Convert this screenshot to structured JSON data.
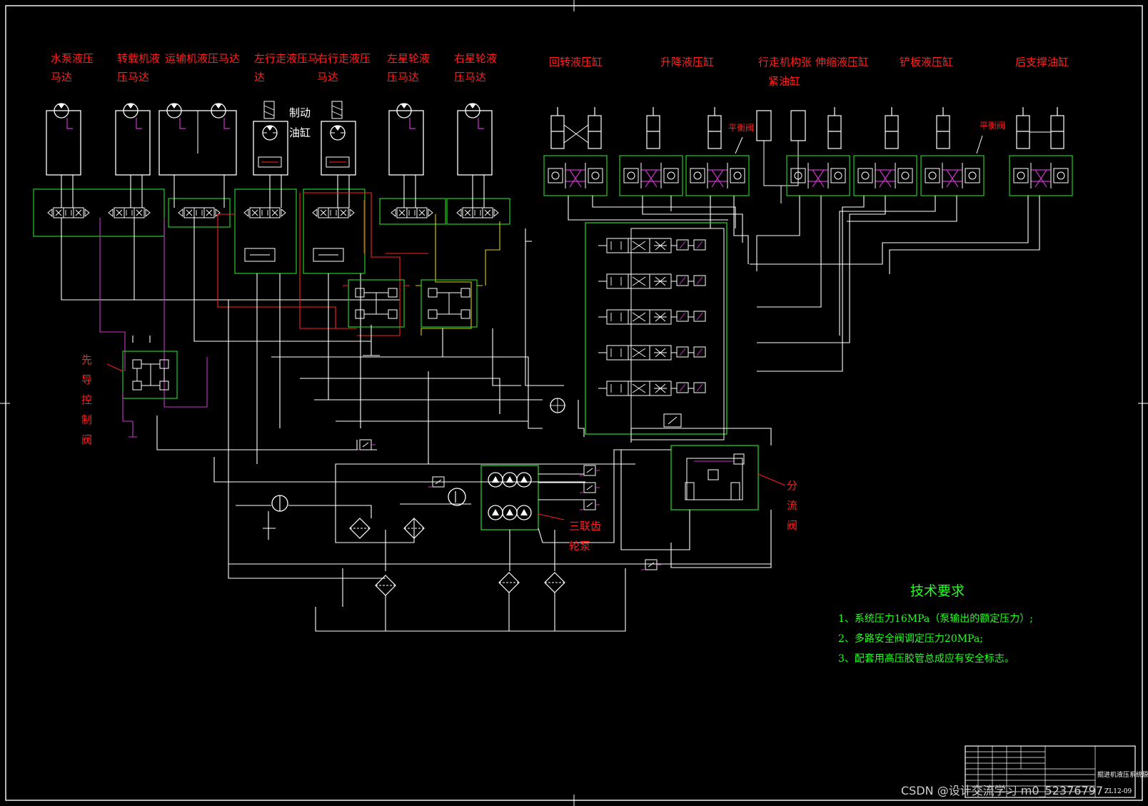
{
  "colors": {
    "background": "#000000",
    "line": "#ffffff",
    "pilot_line": "#cc33cc",
    "travel_line": "#ff2020",
    "planet_line": "#e0d000",
    "frame_green": "#22cc22",
    "label_red": "#ff2020",
    "note_green": "#22ff22"
  },
  "labels": {
    "water_pump_motor": [
      "水泵液压",
      "马达"
    ],
    "loader_motor": [
      "转载机液",
      "压马达"
    ],
    "conveyor_motor": "运输机液压马达",
    "left_travel_motor": [
      "左行走液压马",
      "达"
    ],
    "right_travel_motor": [
      "右行走液压",
      "马达"
    ],
    "left_planet_motor": [
      "左星轮液",
      "压马达"
    ],
    "right_planet_motor": [
      "右星轮液",
      "压马达"
    ],
    "rotary_cylinder": "回转液压缸",
    "lift_cylinder": "升降液压缸",
    "tension_cylinder": [
      "行走机构张",
      "紧油缸"
    ],
    "telescopic_cylinder": "伸缩液压缸",
    "shovel_cylinder": "铲板液压缸",
    "rear_support_cylinder": "后支撑油缸",
    "brake_cylinder": [
      "制动",
      "油缸"
    ],
    "balance_valve_1": "平衡阀",
    "balance_valve_2": "平衡阀",
    "pilot_valve": [
      "先",
      "导",
      "控",
      "制",
      "阀"
    ],
    "triple_pump": [
      "三联齿",
      "轮泵"
    ],
    "flow_divider": [
      "分",
      "流",
      "阀"
    ]
  },
  "tech": {
    "title": "技术要求",
    "items": [
      "1、系统压力16MPa（泵输出的额定压力）;",
      "2、多路安全阀调定压力20MPa;",
      "3、配套用高压胶管总成应有安全标志。"
    ]
  },
  "titleblock": {
    "name": "掘进机液压系统原理图",
    "code": "ZL12-09"
  },
  "watermark": "CSDN @设计交流学习 m0_52376797"
}
